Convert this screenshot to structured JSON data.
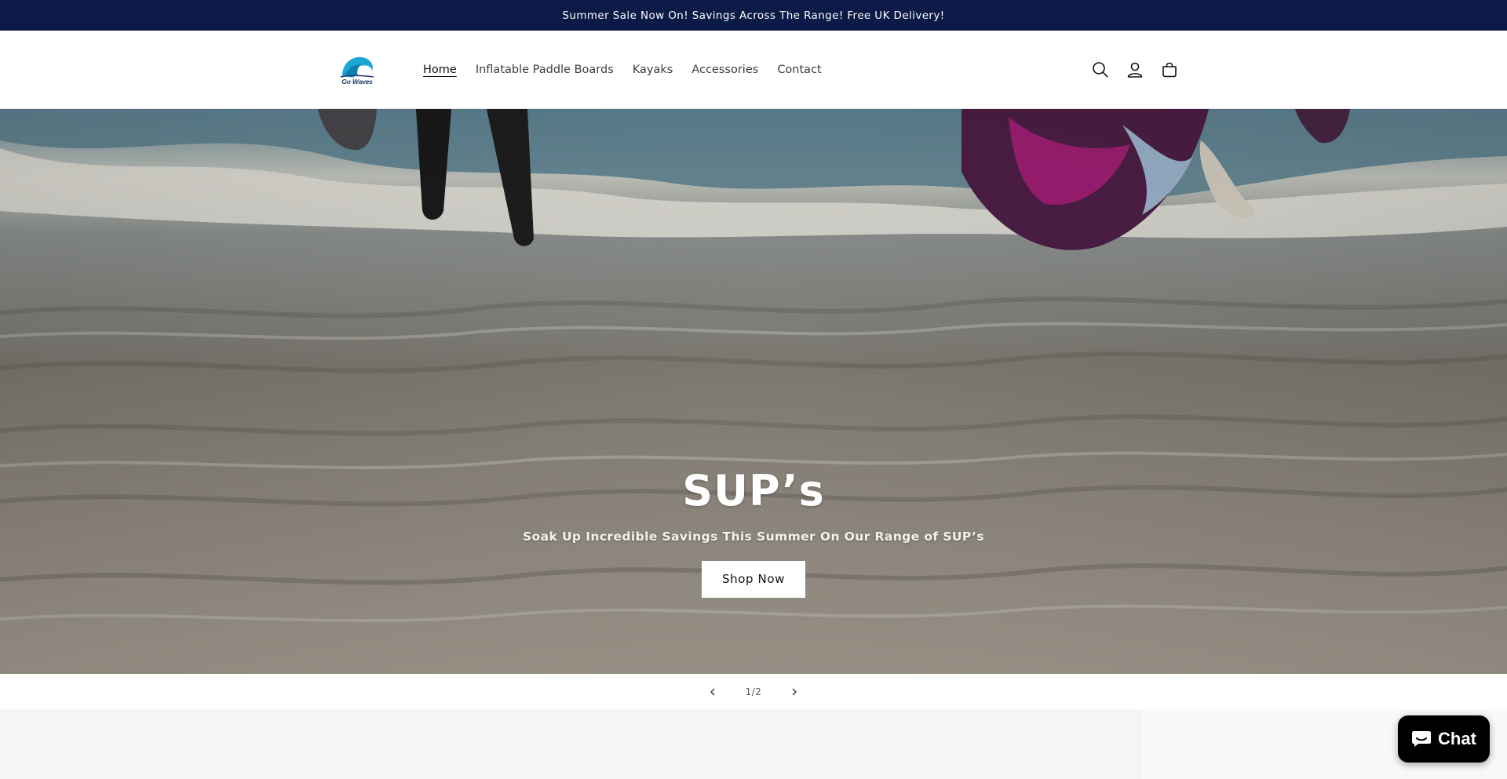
{
  "announcement": {
    "text": "Summer Sale Now On! Savings Across The Range! Free UK Delivery!"
  },
  "header": {
    "logo_text": "Go Waves",
    "nav": [
      {
        "label": "Home",
        "active": true
      },
      {
        "label": "Inflatable Paddle Boards",
        "active": false
      },
      {
        "label": "Kayaks",
        "active": false
      },
      {
        "label": "Accessories",
        "active": false
      },
      {
        "label": "Contact",
        "active": false
      }
    ],
    "icons": [
      "search-icon",
      "account-icon",
      "cart-icon"
    ]
  },
  "hero": {
    "title": "SUP’s",
    "subtitle": "Soak Up Incredible Savings This Summer On Our Range of SUP’s",
    "button_label": "Shop Now"
  },
  "slider": {
    "counter": "1/2",
    "current": 1,
    "total": 2
  },
  "chat": {
    "label": "Chat"
  },
  "colors": {
    "announcement_bg": "#0b1a47",
    "chat_bg": "#000000",
    "logo_blue": "#1aa7d6"
  }
}
